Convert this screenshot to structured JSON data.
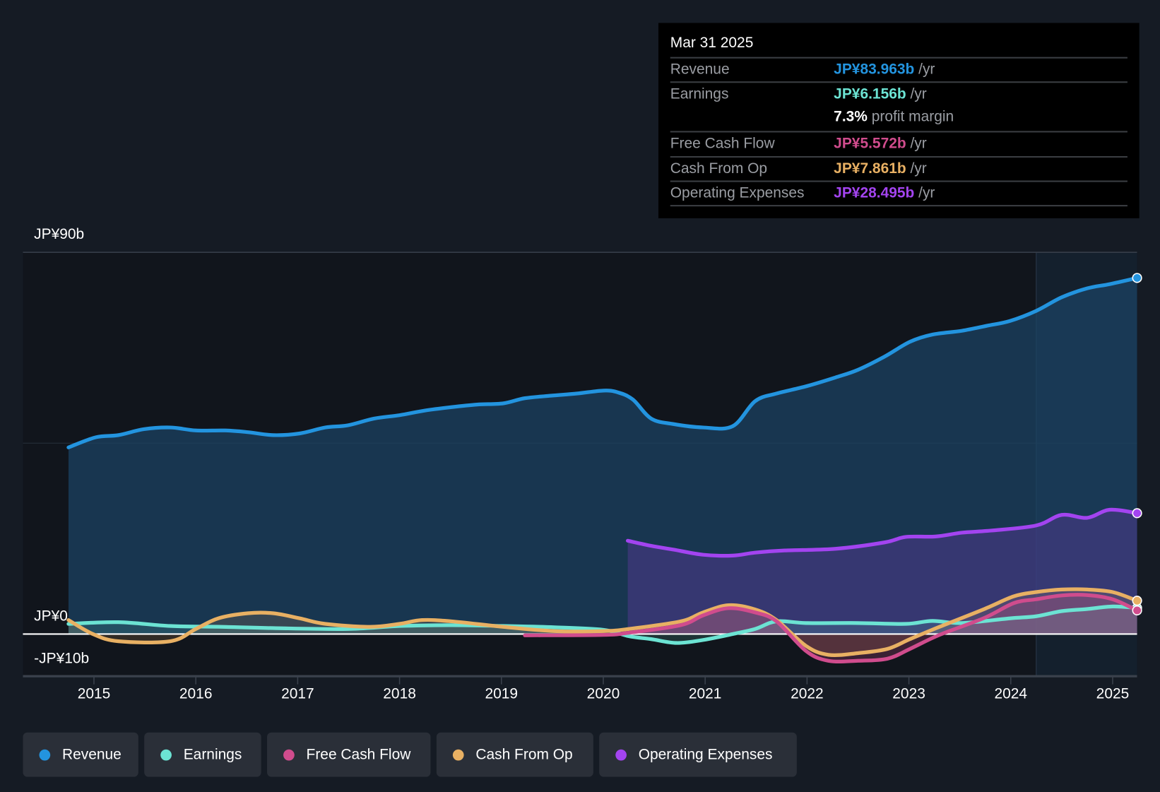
{
  "tooltip": {
    "date": "Mar 31 2025",
    "rows": [
      {
        "label": "Revenue",
        "value": "JP¥83.963b",
        "unit": "/yr",
        "color": "#2394df"
      },
      {
        "label": "Earnings",
        "value": "JP¥6.156b",
        "unit": "/yr",
        "color": "#6ce3d3"
      },
      {
        "label": "",
        "value": "7.3%",
        "unit": "profit margin",
        "color": "#ffffff"
      },
      {
        "label": "Free Cash Flow",
        "value": "JP¥5.572b",
        "unit": "/yr",
        "color": "#d04c8d"
      },
      {
        "label": "Cash From Op",
        "value": "JP¥7.861b",
        "unit": "/yr",
        "color": "#e8b063"
      },
      {
        "label": "Operating Expenses",
        "value": "JP¥28.495b",
        "unit": "/yr",
        "color": "#a344f0"
      }
    ]
  },
  "chart_data": {
    "type": "line",
    "ylim": [
      -10,
      90
    ],
    "xlim": [
      2014.75,
      2025.25
    ],
    "y_tick_labels": [
      "JP¥90b",
      "JP¥0",
      "-JP¥10b"
    ],
    "y_ticks": [
      90,
      0,
      -10
    ],
    "x_tick_labels": [
      "2015",
      "2016",
      "2017",
      "2018",
      "2019",
      "2020",
      "2021",
      "2022",
      "2023",
      "2024",
      "2025"
    ],
    "grid": true,
    "shaded_region_start": 2024.25,
    "legend_placement": "bottom",
    "series": [
      {
        "name": "Revenue",
        "color": "#2394df",
        "area": true,
        "points": [
          [
            2014.75,
            44.0
          ],
          [
            2015.02,
            46.4
          ],
          [
            2015.24,
            46.9
          ],
          [
            2015.49,
            48.3
          ],
          [
            2015.75,
            48.7
          ],
          [
            2016.0,
            48.0
          ],
          [
            2016.29,
            48.0
          ],
          [
            2016.51,
            47.6
          ],
          [
            2016.76,
            46.9
          ],
          [
            2017.02,
            47.3
          ],
          [
            2017.27,
            48.7
          ],
          [
            2017.49,
            49.2
          ],
          [
            2017.75,
            50.8
          ],
          [
            2018.0,
            51.6
          ],
          [
            2018.25,
            52.7
          ],
          [
            2018.51,
            53.5
          ],
          [
            2018.76,
            54.1
          ],
          [
            2019.02,
            54.4
          ],
          [
            2019.23,
            55.6
          ],
          [
            2019.49,
            56.2
          ],
          [
            2019.74,
            56.7
          ],
          [
            2020.0,
            57.4
          ],
          [
            2020.14,
            57.0
          ],
          [
            2020.29,
            55.3
          ],
          [
            2020.47,
            50.8
          ],
          [
            2020.69,
            49.5
          ],
          [
            2020.98,
            48.7
          ],
          [
            2021.27,
            49.0
          ],
          [
            2021.49,
            54.9
          ],
          [
            2021.7,
            56.7
          ],
          [
            2021.99,
            58.4
          ],
          [
            2022.28,
            60.5
          ],
          [
            2022.5,
            62.3
          ],
          [
            2022.76,
            65.4
          ],
          [
            2023.01,
            68.9
          ],
          [
            2023.23,
            70.6
          ],
          [
            2023.52,
            71.5
          ],
          [
            2023.77,
            72.7
          ],
          [
            2023.99,
            73.8
          ],
          [
            2024.25,
            76.2
          ],
          [
            2024.5,
            79.4
          ],
          [
            2024.75,
            81.5
          ],
          [
            2024.97,
            82.5
          ],
          [
            2025.24,
            83.96
          ]
        ]
      },
      {
        "name": "Earnings",
        "color": "#6ce3d3",
        "area": true,
        "points": [
          [
            2014.75,
            2.4
          ],
          [
            2015.24,
            2.8
          ],
          [
            2015.75,
            1.9
          ],
          [
            2016.26,
            1.7
          ],
          [
            2016.76,
            1.4
          ],
          [
            2017.49,
            1.2
          ],
          [
            2018.0,
            1.9
          ],
          [
            2018.51,
            2.1
          ],
          [
            2019.02,
            1.9
          ],
          [
            2019.52,
            1.6
          ],
          [
            2020.0,
            1.0
          ],
          [
            2020.25,
            -0.5
          ],
          [
            2020.47,
            -1.2
          ],
          [
            2020.72,
            -2.1
          ],
          [
            2020.98,
            -1.4
          ],
          [
            2021.27,
            0.0
          ],
          [
            2021.49,
            1.2
          ],
          [
            2021.7,
            3.0
          ],
          [
            2021.99,
            2.6
          ],
          [
            2022.5,
            2.6
          ],
          [
            2022.97,
            2.4
          ],
          [
            2023.23,
            3.1
          ],
          [
            2023.52,
            2.6
          ],
          [
            2023.99,
            3.7
          ],
          [
            2024.25,
            4.2
          ],
          [
            2024.5,
            5.4
          ],
          [
            2024.75,
            5.9
          ],
          [
            2025.0,
            6.5
          ],
          [
            2025.24,
            6.16
          ]
        ]
      },
      {
        "name": "Free Cash Flow",
        "color": "#d04c8d",
        "area": true,
        "points": [
          [
            2019.23,
            -0.3
          ],
          [
            2020.0,
            -0.2
          ],
          [
            2020.25,
            0.3
          ],
          [
            2020.76,
            2.1
          ],
          [
            2020.98,
            4.4
          ],
          [
            2021.23,
            6.1
          ],
          [
            2021.49,
            5.1
          ],
          [
            2021.7,
            3.0
          ],
          [
            2021.99,
            -4.0
          ],
          [
            2022.21,
            -6.3
          ],
          [
            2022.5,
            -6.3
          ],
          [
            2022.79,
            -5.8
          ],
          [
            2023.01,
            -3.5
          ],
          [
            2023.3,
            -0.2
          ],
          [
            2023.74,
            3.8
          ],
          [
            2024.03,
            7.3
          ],
          [
            2024.25,
            8.2
          ],
          [
            2024.5,
            9.1
          ],
          [
            2024.75,
            9.2
          ],
          [
            2025.0,
            8.2
          ],
          [
            2025.24,
            5.57
          ]
        ]
      },
      {
        "name": "Cash From Op",
        "color": "#e8b063",
        "area": true,
        "points": [
          [
            2014.75,
            3.3
          ],
          [
            2014.99,
            0.0
          ],
          [
            2015.24,
            -1.7
          ],
          [
            2015.75,
            -1.7
          ],
          [
            2016.0,
            1.2
          ],
          [
            2016.22,
            3.7
          ],
          [
            2016.51,
            4.9
          ],
          [
            2016.76,
            4.9
          ],
          [
            2017.02,
            3.7
          ],
          [
            2017.27,
            2.4
          ],
          [
            2017.71,
            1.7
          ],
          [
            2018.0,
            2.4
          ],
          [
            2018.22,
            3.3
          ],
          [
            2018.51,
            3.0
          ],
          [
            2019.02,
            1.7
          ],
          [
            2019.52,
            0.7
          ],
          [
            2020.0,
            0.7
          ],
          [
            2020.25,
            1.2
          ],
          [
            2020.76,
            3.0
          ],
          [
            2020.98,
            5.1
          ],
          [
            2021.23,
            6.8
          ],
          [
            2021.49,
            5.8
          ],
          [
            2021.7,
            3.3
          ],
          [
            2021.99,
            -2.8
          ],
          [
            2022.21,
            -4.9
          ],
          [
            2022.5,
            -4.5
          ],
          [
            2022.79,
            -3.5
          ],
          [
            2023.01,
            -1.2
          ],
          [
            2023.3,
            1.7
          ],
          [
            2023.74,
            5.9
          ],
          [
            2024.03,
            8.9
          ],
          [
            2024.25,
            9.9
          ],
          [
            2024.5,
            10.5
          ],
          [
            2024.75,
            10.5
          ],
          [
            2025.0,
            9.9
          ],
          [
            2025.24,
            7.86
          ]
        ]
      },
      {
        "name": "Operating Expenses",
        "color": "#a344f0",
        "area": true,
        "points": [
          [
            2020.24,
            22.0
          ],
          [
            2020.47,
            20.8
          ],
          [
            2020.69,
            19.9
          ],
          [
            2020.98,
            18.7
          ],
          [
            2021.27,
            18.5
          ],
          [
            2021.49,
            19.2
          ],
          [
            2021.78,
            19.7
          ],
          [
            2022.28,
            20.1
          ],
          [
            2022.76,
            21.6
          ],
          [
            2022.97,
            22.9
          ],
          [
            2023.26,
            23.0
          ],
          [
            2023.52,
            23.9
          ],
          [
            2023.81,
            24.4
          ],
          [
            2024.25,
            25.6
          ],
          [
            2024.5,
            28.1
          ],
          [
            2024.75,
            27.4
          ],
          [
            2024.97,
            29.3
          ],
          [
            2025.24,
            28.5
          ]
        ]
      }
    ]
  },
  "legend": [
    {
      "label": "Revenue",
      "color": "#2394df"
    },
    {
      "label": "Earnings",
      "color": "#6ce3d3"
    },
    {
      "label": "Free Cash Flow",
      "color": "#d04c8d"
    },
    {
      "label": "Cash From Op",
      "color": "#e8b063"
    },
    {
      "label": "Operating Expenses",
      "color": "#a344f0"
    }
  ]
}
